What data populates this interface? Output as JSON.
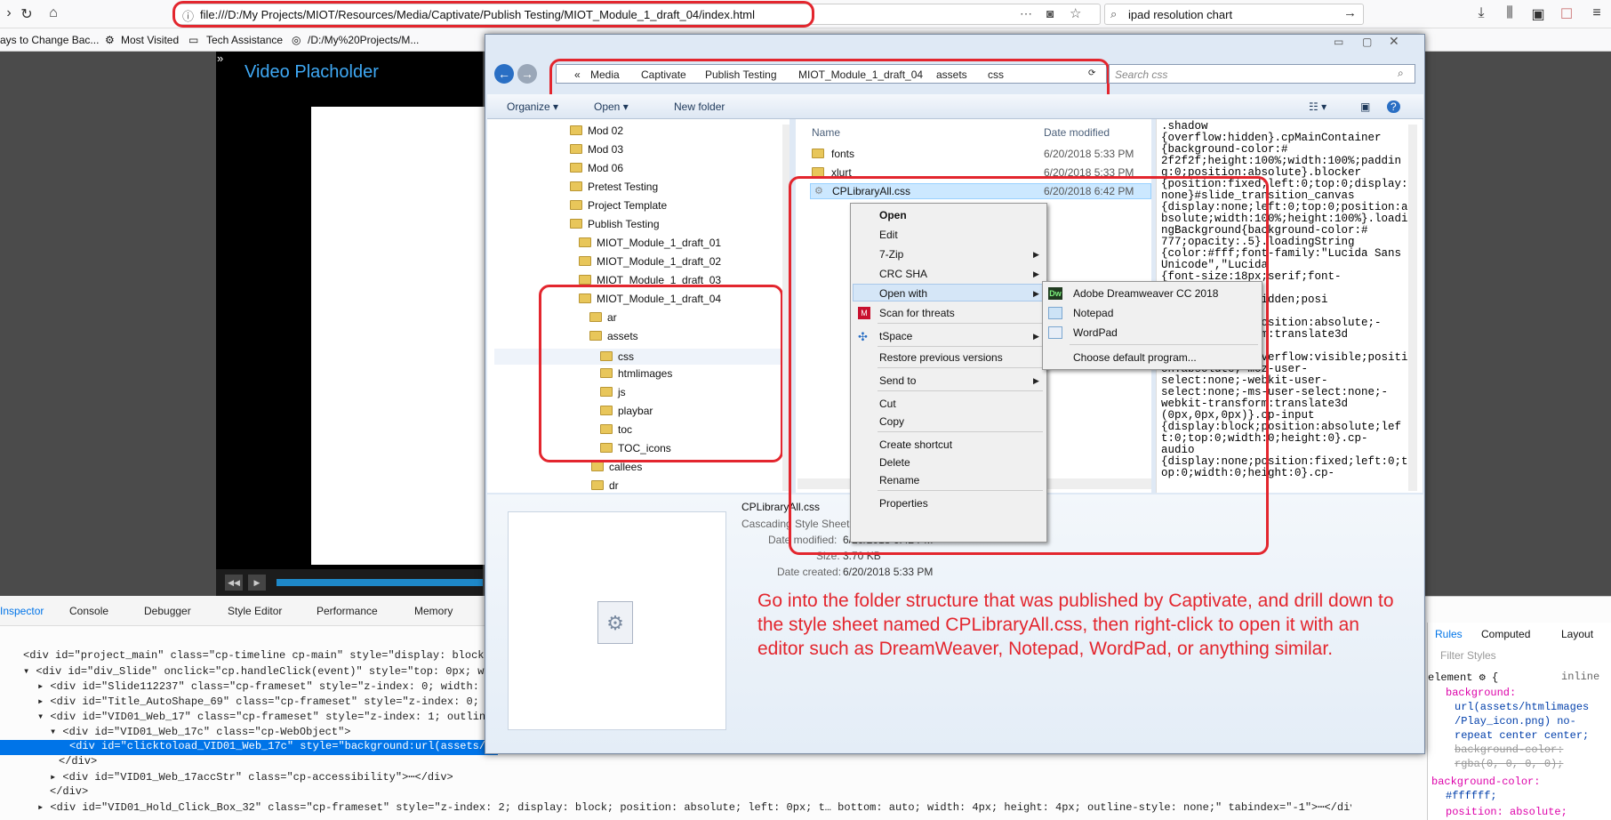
{
  "browser": {
    "url": "file:///D:/My Projects/MIOT/Resources/Media/Captivate/Publish Testing/MIOT_Module_1_draft_04/index.html",
    "search_text": "ipad resolution chart",
    "bookmarks": [
      "ays to Change Bac...",
      "Most Visited",
      "Tech Assistance",
      "/D:/My%20Projects/M..."
    ]
  },
  "page": {
    "video_title": "Video Placholder"
  },
  "explorer": {
    "breadcrumbs": [
      "«",
      "Media",
      "Captivate",
      "Publish Testing",
      "MIOT_Module_1_draft_04",
      "assets",
      "css"
    ],
    "search_placeholder": "Search css",
    "commands": {
      "organize": "Organize ▾",
      "open": "Open ▾",
      "new_folder": "New folder"
    },
    "tree": [
      "Mod 02",
      "Mod 03",
      "Mod 06",
      "Pretest Testing",
      "Project Template",
      "Publish Testing",
      "MIOT_Module_1_draft_01",
      "MIOT_Module_1_draft_02",
      "MIOT_Module_1_draft_03",
      "MIOT_Module_1_draft_04",
      "ar",
      "assets",
      "css",
      "htmlimages",
      "js",
      "playbar",
      "toc",
      "TOC_icons",
      "callees",
      "dr"
    ],
    "columns": {
      "name": "Name",
      "date": "Date modified"
    },
    "files": [
      {
        "name": "fonts",
        "date": "6/20/2018 5:33 PM"
      },
      {
        "name": "xlurt",
        "date": "6/20/2018 5:33 PM"
      },
      {
        "name": "CPLibraryAll.css",
        "date": "6/20/2018 6:42 PM"
      }
    ],
    "preview_text": ".shadow\n{overflow:hidden}.cpMainContainer\n{background-color:#\n2f2f2f;height:100%;width:100%;padding:0;position:absolute}.blocker\n{position:fixed;left:0;top:0;display:none}#slide_transition_canvas\n{display:none;left:0;top:0;position:absolute;width:100%;height:100%}.loadingBackground{background-color:#\n777;opacity:.5}.loadingString\n{color:#fff;font-family:\"Lucida Sans Unicode\",\"Lucida\n{font-size:18px;serif;font-\nmovie\nover{overflow:hidden;posi\n.cp-rewrap\n{display:none;position:absolute;-\nwebkit-transform:translate3d\n.cp-frameset\n{display:none;overflow:visible;position:absolute;-moz-user-\nselect:none;-webkit-user-\nselect:none;-ms-user-select:none;-\nwebkit-transform:translate3d\n(0px,0px,0px)}.cp-input\n{display:block;position:absolute;left:0;top:0;width:0;height:0}.cp-\naudio\n{display:none;position:fixed;left:0;top:0;width:0;height:0}.cp-",
    "details": {
      "name": "CPLibraryAll.css",
      "type": "Cascading Style Sheet D",
      "modified_label": "Date modified:",
      "modified": "6/20/2018 6:42 PM",
      "size_label": "Size:",
      "size": "3.70 KB",
      "created_label": "Date created:",
      "created": "6/20/2018 5:33 PM"
    },
    "note": "Go into the folder structure that was published by Captivate, and drill down to the style sheet named CPLibraryAll.css, then right-click to open it with an editor such as DreamWeaver, Notepad, WordPad, or anything similar."
  },
  "context_menu": [
    "Open",
    "Edit",
    "7-Zip",
    "CRC SHA",
    "Open with",
    "Scan for threats",
    "tSpace",
    "Restore previous versions",
    "Send to",
    "Cut",
    "Copy",
    "Create shortcut",
    "Delete",
    "Rename",
    "Properties"
  ],
  "open_with": [
    "Adobe Dreamweaver CC 2018",
    "Notepad",
    "WordPad",
    "Choose default program..."
  ],
  "devtools": {
    "tabs": [
      "Inspector",
      "Console",
      "Debugger",
      "Style Editor",
      "Performance",
      "Memory"
    ],
    "code": [
      "<div id=\"project_main\" class=\"cp-timeline cp-main\" style=\"display: block;\"",
      "▾ <div id=\"div_Slide\" onclick=\"cp.handleClick(event)\" style=\"top: 0px; wid",
      "▸ <div id=\"Slide112237\" class=\"cp-frameset\" style=\"z-index: 0; width: 10",
      "▸ <div id=\"Title_AutoShape_69\" class=\"cp-frameset\" style=\"z-index: 0; ou",
      "▾ <div id=\"VID01_Web_17\" class=\"cp-frameset\" style=\"z-index: 1; outline-",
      "▾ <div id=\"VID01_Web_17c\" class=\"cp-WebObject\">",
      "<div id=\"clicktoload_VID01_Web_17c\" style=\"background:url(assets/ht",
      "</div>",
      "▸ <div id=\"VID01_Web_17accStr\" class=\"cp-accessibility\">⋯</div>",
      "</div>",
      "▸ <div id=\"VID01_Hold_Click_Box_32\" class=\"cp-frameset\" style=\"z-index: 2; display: block; position: absolute; left: 0px; t… bottom: auto; width: 4px; height: 4px; outline-style: none;\" tabindex=\"-1\">⋯</div>",
      "</div>"
    ],
    "rules_tabs": [
      "Rules",
      "Computed",
      "Layout"
    ],
    "filter_placeholder": "Filter Styles",
    "rules": [
      "element ⚙ {",
      "inline",
      "background:",
      "url(assets/htmlimages",
      "/Play_icon.png) no-",
      "repeat center center;",
      "background-color:",
      "rgba(0, 0, 0, 0);",
      "background-color:",
      "#ffffff;",
      "position: absolute;"
    ]
  }
}
